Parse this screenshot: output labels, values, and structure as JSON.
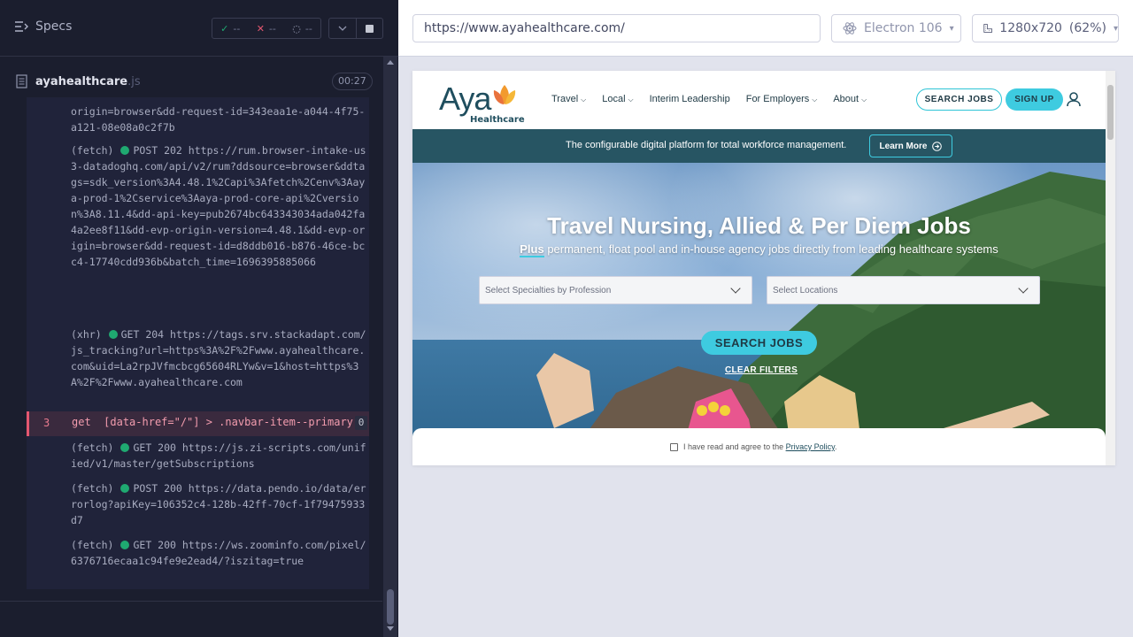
{
  "reporter": {
    "specs_label": "Specs",
    "stats": {
      "passed": "--",
      "failed": "--",
      "pending": "--"
    },
    "spec": {
      "name": "ayahealthcare",
      "ext": ".js",
      "time": "00:27"
    },
    "log": [
      {
        "text": "origin=browser&dd-request-id=343eaa1e-a044-4f75-a121-08e08a0c2f7b"
      },
      {
        "prefix": "(fetch)",
        "method": "POST 202",
        "text": "https://rum.browser-intake-us3-datadoghq.com/api/v2/rum?ddsource=browser&ddtags=sdk_version%3A4.48.1%2Capi%3Afetch%2Cenv%3Aaya-prod-1%2Cservice%3Aaya-prod-core-api%2Cversion%3A8.11.4&dd-api-key=pub2674bc643343034ada042fa4a2ee8f11&dd-evp-origin-version=4.48.1&dd-evp-origin=browser&dd-request-id=d8ddb016-b876-46ce-bcc4-17740cdd936b&batch_time=1696395885066"
      },
      {
        "prefix": "(xhr)",
        "method": "GET 204",
        "text": "https://tags.srv.stackadapt.com/js_tracking?url=https%3A%2F%2Fwww.ayahealthcare.com&uid=La2rpJVfmcbcg65604RLYw&v=1&host=https%3A%2F%2Fwww.ayahealthcare.com"
      },
      {
        "prefix": "(fetch)",
        "method": "GET 200",
        "text": "https://js.zi-scripts.com/unified/v1/master/getSubscriptions"
      },
      {
        "prefix": "(fetch)",
        "method": "POST 200",
        "text": "https://data.pendo.io/data/errorlog?apiKey=106352c4-128b-42ff-70cf-1f79475933d7"
      },
      {
        "prefix": "(fetch)",
        "method": "GET 200",
        "text": "https://ws.zoominfo.com/pixel/6376716ecaa1c94fe9e2ead4/?iszitag=true"
      }
    ],
    "command": {
      "number": "3",
      "name": "get",
      "selector": "[data-href=\"/\"] > .navbar-item--primary",
      "count": "0"
    }
  },
  "aut": {
    "url": "https://www.ayahealthcare.com/",
    "browser": "Electron 106",
    "viewport": "1280x720",
    "zoom": "(62%)"
  },
  "site": {
    "logo_text": "Aya",
    "logo_sub": "Healthcare",
    "nav": [
      "Travel",
      "Local",
      "Interim Leadership",
      "For Employers",
      "About"
    ],
    "nav_has_caret": [
      true,
      true,
      false,
      true,
      true
    ],
    "search_jobs": "SEARCH JOBS",
    "sign_up": "SIGN UP",
    "promo_text": "The configurable digital platform for total workforce management.",
    "learn_more": "Learn More",
    "hero_title": "Travel Nursing, Allied & Per Diem Jobs",
    "hero_sub_lead": "Plus",
    "hero_sub_rest": " permanent, float pool and in-house agency jobs directly from leading healthcare systems",
    "specialty_placeholder": "Select Specialties by Profession",
    "location_placeholder": "Select Locations",
    "hero_search": "SEARCH JOBS",
    "clear_filters": "CLEAR FILTERS",
    "consent_prefix": "I have read and agree to the ",
    "consent_link": "Privacy Policy",
    "consent_suffix": "."
  },
  "colors": {
    "accent": "#3ecbe0",
    "brand": "#1f4e5e",
    "promo_bg": "#275563",
    "fail": "#e45770",
    "pass": "#1fa971"
  }
}
